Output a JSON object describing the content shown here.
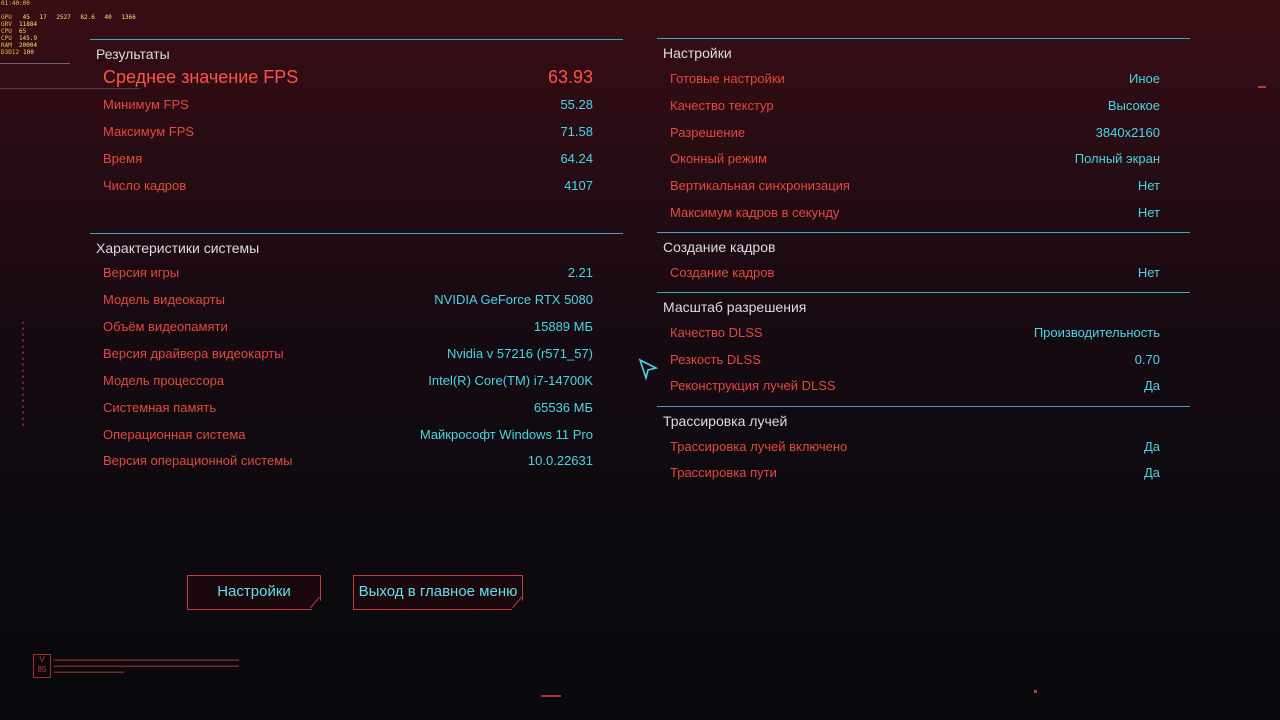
{
  "osd": {
    "time": "01:40:00",
    "rows": [
      {
        "label": "GPU",
        "values": [
          "45",
          "17",
          "2527",
          "82.6",
          "40",
          "1366"
        ]
      },
      {
        "label": "GRV",
        "values": [
          "11884"
        ]
      },
      {
        "label": "CPU",
        "values": [
          "65"
        ]
      },
      {
        "label": "CPU",
        "values": [
          "145.9"
        ]
      },
      {
        "label": "RAM",
        "values": [
          "20004"
        ]
      },
      {
        "label": "D3D12",
        "values": [
          "100"
        ]
      }
    ]
  },
  "results": {
    "title": "Результаты",
    "average": {
      "label": "Среднее значение FPS",
      "value": "63.93"
    },
    "rows": [
      {
        "label": "Минимум FPS",
        "value": "55.28"
      },
      {
        "label": "Максимум FPS",
        "value": "71.58"
      },
      {
        "label": "Время",
        "value": "64.24"
      },
      {
        "label": "Число кадров",
        "value": "4107"
      }
    ]
  },
  "system": {
    "title": "Характеристики системы",
    "rows": [
      {
        "label": "Версия игры",
        "value": "2.21"
      },
      {
        "label": "Модель видеокарты",
        "value": "NVIDIA GeForce RTX 5080"
      },
      {
        "label": "Объём видеопамяти",
        "value": "15889 МБ"
      },
      {
        "label": "Версия драйвера видеокарты",
        "value": "Nvidia v 57216 (r571_57)"
      },
      {
        "label": "Модель процессора",
        "value": "Intel(R) Core(TM) i7-14700K"
      },
      {
        "label": "Системная память",
        "value": "65536 МБ"
      },
      {
        "label": "Операционная система",
        "value": "Майкрософт Windows 11 Pro"
      },
      {
        "label": "Версия операционной системы",
        "value": "10.0.22631"
      }
    ]
  },
  "settings": {
    "title": "Настройки",
    "rows": [
      {
        "label": "Готовые настройки",
        "value": "Иное"
      },
      {
        "label": "Качество текстур",
        "value": "Высокое"
      },
      {
        "label": "Разрешение",
        "value": "3840x2160"
      },
      {
        "label": "Оконный режим",
        "value": "Полный экран"
      },
      {
        "label": "Вертикальная синхронизация",
        "value": "Нет"
      },
      {
        "label": "Максимум кадров в секунду",
        "value": "Нет"
      }
    ]
  },
  "framegen": {
    "title": "Создание кадров",
    "rows": [
      {
        "label": "Создание кадров",
        "value": "Нет"
      }
    ]
  },
  "scaling": {
    "title": "Масштаб разрешения",
    "rows": [
      {
        "label": "Качество DLSS",
        "value": "Производительность"
      },
      {
        "label": "Резкость DLSS",
        "value": "0.70"
      },
      {
        "label": "Реконструкция лучей DLSS",
        "value": "Да"
      }
    ]
  },
  "raytracing": {
    "title": "Трассировка лучей",
    "rows": [
      {
        "label": "Трассировка лучей включено",
        "value": "Да"
      },
      {
        "label": "Трассировка пути",
        "value": "Да"
      }
    ]
  },
  "buttons": {
    "settings": "Настройки",
    "main_menu": "Выход в главное меню"
  },
  "colors": {
    "label": "#e2493f",
    "value": "#49d6e3",
    "accent_line": "#3aa8b8",
    "button_border": "#c33b3b"
  }
}
